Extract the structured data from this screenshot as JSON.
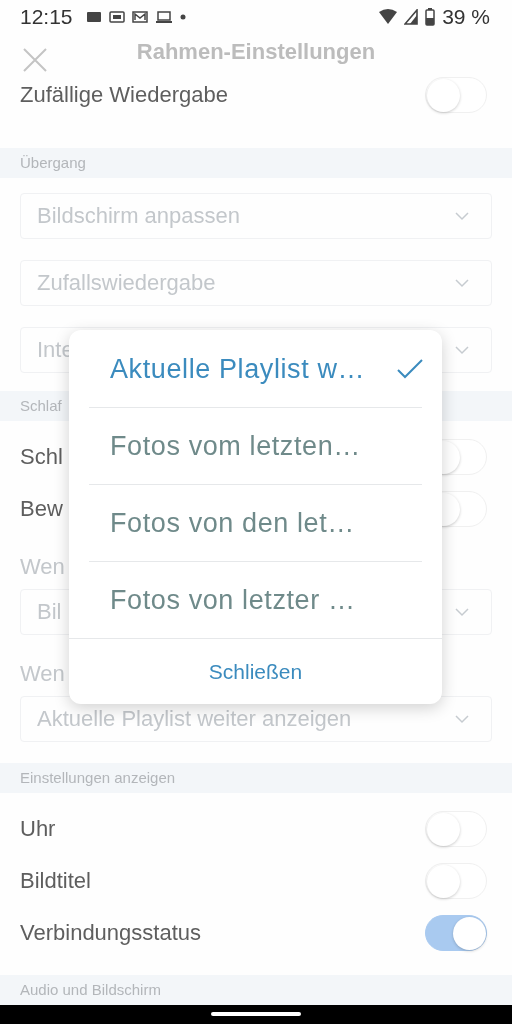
{
  "status_bar": {
    "time": "12:15",
    "battery": "39 %"
  },
  "header": {
    "title": "Rahmen-Einstellungen"
  },
  "content": [
    {
      "kind": "toggle",
      "label": "Zufällige Wiedergabe",
      "on": false
    },
    {
      "kind": "section",
      "label": "Übergang"
    },
    {
      "kind": "select",
      "value": "Bildschirm anpassen"
    },
    {
      "kind": "select",
      "value": "Zufallswiedergabe"
    },
    {
      "kind": "select",
      "value": "Inte"
    },
    {
      "kind": "section",
      "label": "Schlaf"
    },
    {
      "kind": "toggle",
      "label": "Schl",
      "on": false
    },
    {
      "kind": "toggle",
      "label": "Bew",
      "on": false
    },
    {
      "kind": "label",
      "text": "Wen"
    },
    {
      "kind": "select",
      "value": "Bil"
    },
    {
      "kind": "label",
      "text": "Wen"
    },
    {
      "kind": "select",
      "value": "Aktuelle Playlist weiter anzeigen"
    },
    {
      "kind": "section",
      "label": "Einstellungen anzeigen"
    },
    {
      "kind": "toggle",
      "label": "Uhr",
      "on": false
    },
    {
      "kind": "toggle",
      "label": "Bildtitel",
      "on": false
    },
    {
      "kind": "toggle",
      "label": "Verbindungsstatus",
      "on": true
    },
    {
      "kind": "section",
      "label": "Audio und Bildschirm"
    }
  ],
  "dialog": {
    "options": [
      {
        "label": "Aktuelle Playlist w…",
        "selected": true
      },
      {
        "label": "Fotos vom letzten…",
        "selected": false
      },
      {
        "label": "Fotos von den let…",
        "selected": false
      },
      {
        "label": "Fotos von letzter …",
        "selected": false
      }
    ],
    "close_button": "Schließen"
  }
}
